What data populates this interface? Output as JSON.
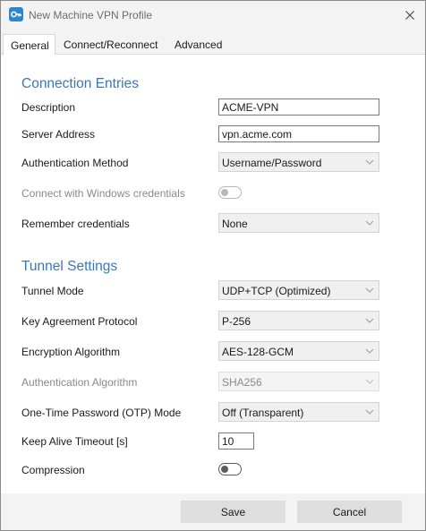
{
  "window": {
    "title": "New Machine VPN Profile",
    "close_icon": "close-icon",
    "app_icon": "vpn-app-icon",
    "accent_color": "#3a78b5"
  },
  "tabs": [
    {
      "label": "General",
      "active": true
    },
    {
      "label": "Connect/Reconnect",
      "active": false
    },
    {
      "label": "Advanced",
      "active": false
    }
  ],
  "connection": {
    "title": "Connection Entries",
    "description_label": "Description",
    "description_value": "ACME-VPN",
    "server_label": "Server Address",
    "server_value": "vpn.acme.com",
    "auth_method_label": "Authentication Method",
    "auth_method_value": "Username/Password",
    "windows_creds_label": "Connect with Windows credentials",
    "windows_creds_on": false,
    "remember_label": "Remember credentials",
    "remember_value": "None"
  },
  "tunnel": {
    "title": "Tunnel Settings",
    "mode_label": "Tunnel Mode",
    "mode_value": "UDP+TCP (Optimized)",
    "key_label": "Key Agreement Protocol",
    "key_value": "P-256",
    "enc_label": "Encryption Algorithm",
    "enc_value": "AES-128-GCM",
    "auth_alg_label": "Authentication Algorithm",
    "auth_alg_value": "SHA256",
    "otp_label": "One-Time Password (OTP) Mode",
    "otp_value": "Off (Transparent)",
    "keepalive_label": "Keep Alive Timeout [s]",
    "keepalive_value": "10",
    "compression_label": "Compression",
    "compression_on": false
  },
  "footer": {
    "save_label": "Save",
    "cancel_label": "Cancel"
  }
}
